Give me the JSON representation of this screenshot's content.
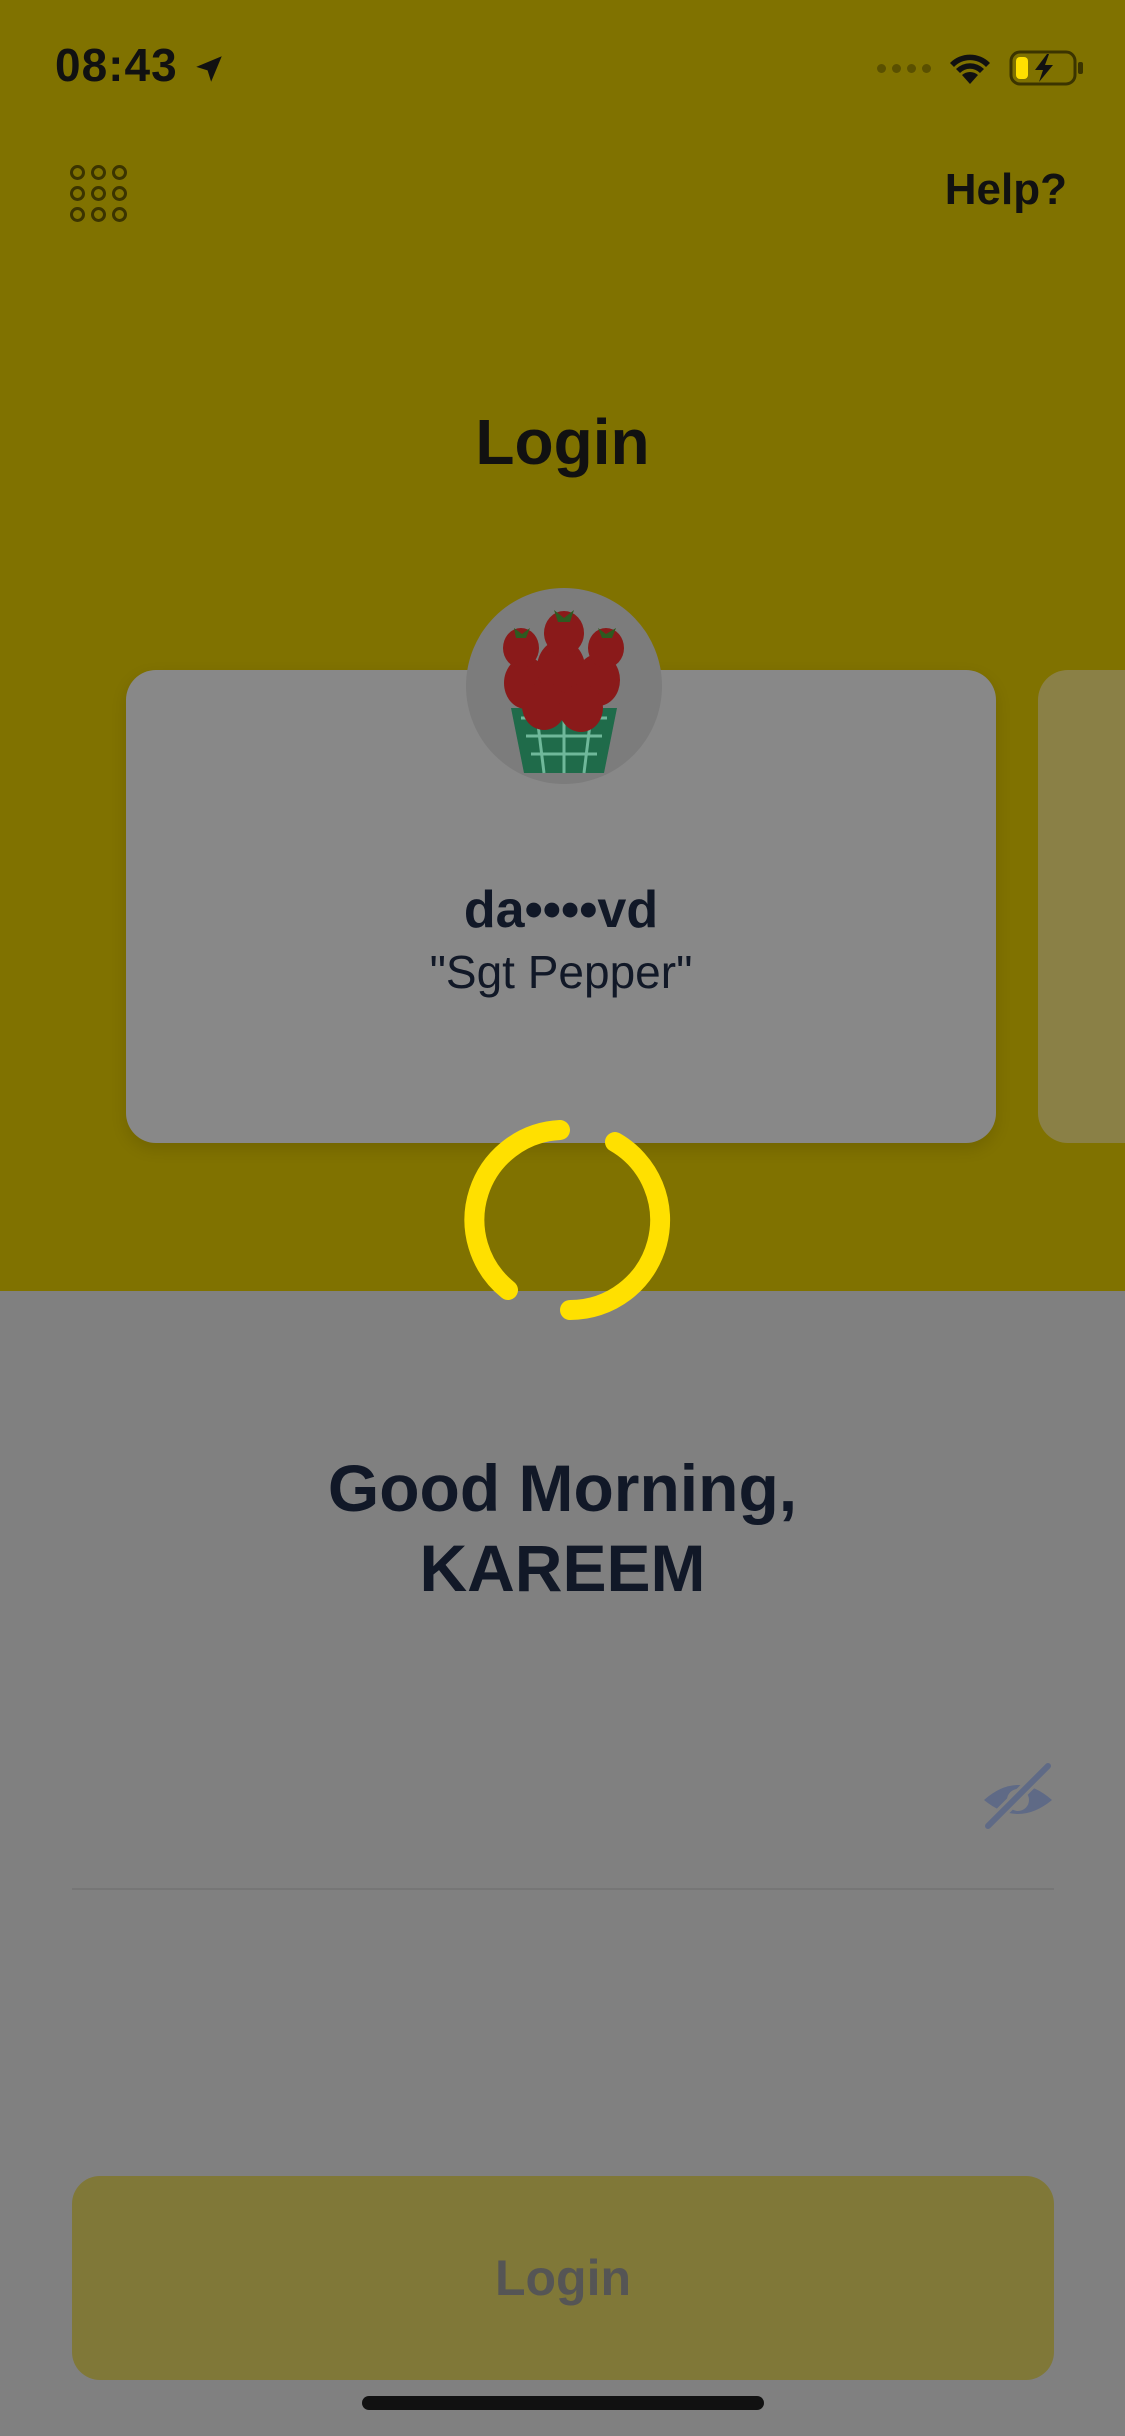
{
  "status_bar": {
    "time": "08:43"
  },
  "header": {
    "help_label": "Help?",
    "title": "Login"
  },
  "account_card": {
    "username": "da••••vd",
    "nickname": "\"Sgt Pepper\""
  },
  "greeting": {
    "line1": "Good Morning,",
    "line2": "KAREEM"
  },
  "password_field": {
    "value": ""
  },
  "login_button": {
    "label": "Login"
  },
  "colors": {
    "spinner": "#FFE000",
    "header_bg": "#807200",
    "body_bg": "#808080"
  },
  "icons": [
    "location-arrow-icon",
    "wifi-icon",
    "battery-charging-icon",
    "keypad-icon",
    "eye-slash-icon"
  ]
}
